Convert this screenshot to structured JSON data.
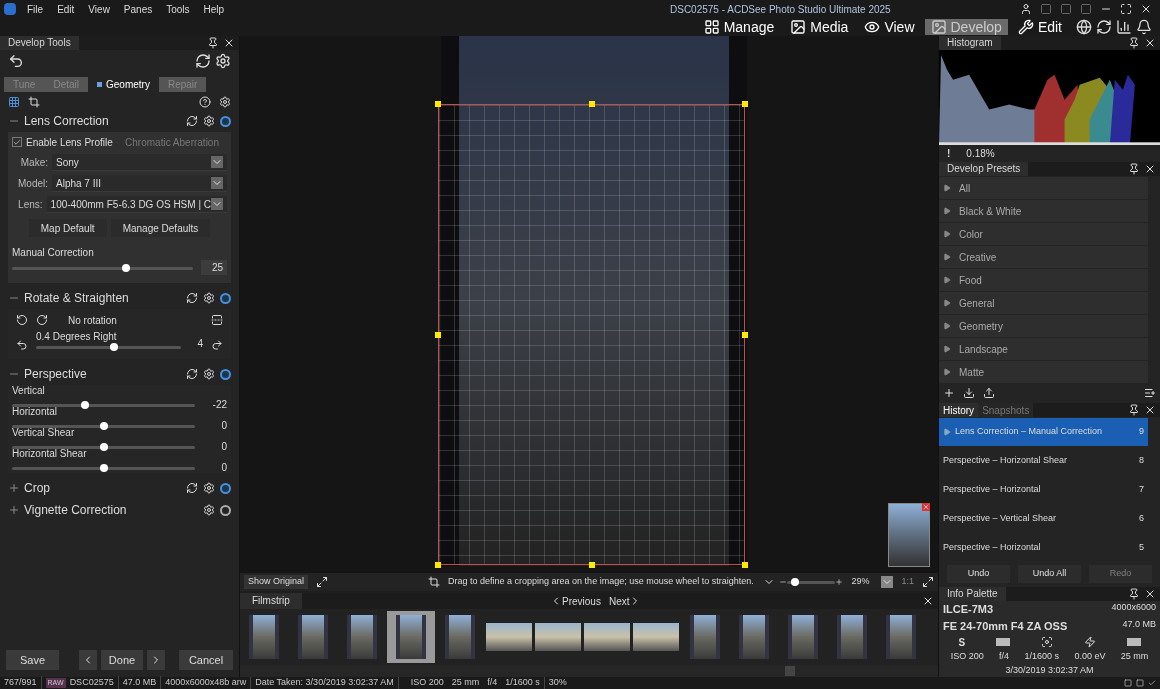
{
  "menu": [
    "File",
    "Edit",
    "View",
    "Panes",
    "Tools",
    "Help"
  ],
  "window": {
    "title": "DSC02575 - ACDSee Photo Studio Ultimate 2025"
  },
  "modes": [
    {
      "label": "Manage",
      "selected": false
    },
    {
      "label": "Media",
      "selected": false
    },
    {
      "label": "View",
      "selected": false
    },
    {
      "label": "Develop",
      "selected": true
    },
    {
      "label": "Edit",
      "selected": false
    }
  ],
  "develop_tools": {
    "title": "Develop Tools",
    "tabs": [
      {
        "label": "Tune",
        "selected": false
      },
      {
        "label": "Detail",
        "selected": false
      },
      {
        "label": "Geometry",
        "selected": true
      },
      {
        "label": "Repair",
        "selected": false
      }
    ]
  },
  "sections": [
    {
      "kind": "lens",
      "title": "Lens Correction",
      "expanded": true,
      "enabled": true,
      "profile": {
        "label": "Enable Lens Profile",
        "checked": true
      },
      "aberration": "Chromatic Aberration",
      "fields": [
        {
          "label": "Make:",
          "value": "Sony"
        },
        {
          "label": "Model:",
          "value": "Alpha 7 III"
        },
        {
          "label": "Lens:",
          "value": "100-400mm F5-6.3 DG OS HSM | C"
        }
      ],
      "buttons": [
        "Map Default",
        "Manage Defaults"
      ],
      "slider": {
        "label": "Manual Correction",
        "level": 0.63,
        "reading": "25"
      }
    },
    {
      "kind": "rotate",
      "title": "Rotate & Straighten",
      "expanded": true,
      "enabled": true,
      "status": "No rotation",
      "slider": {
        "label": "0.4 Degrees Right",
        "level": 0.54,
        "reading": "4"
      }
    },
    {
      "kind": "perspective",
      "title": "Perspective",
      "expanded": true,
      "enabled": true,
      "sliders": [
        {
          "label": "Vertical",
          "level": 0.4,
          "reading": "-22"
        },
        {
          "label": "Horizontal",
          "level": 0.5,
          "reading": "0"
        },
        {
          "label": "Vertical Shear",
          "level": 0.5,
          "reading": "0"
        },
        {
          "label": "Horizontal Shear",
          "level": 0.5,
          "reading": "0"
        }
      ]
    },
    {
      "kind": "crop",
      "title": "Crop",
      "expanded": false,
      "enabled": true
    },
    {
      "kind": "vignette",
      "title": "Vignette Correction",
      "expanded": false,
      "enabled": false
    }
  ],
  "footer_buttons": {
    "save": "Save",
    "done": "Done",
    "cancel": "Cancel"
  },
  "viewer_bar": {
    "show_original": "Show Original",
    "hint": "Drag to define a cropping area on the image; use mouse wheel to straighten.",
    "zoom": {
      "level": 0.15
    },
    "zoom_reading": "29%",
    "actual_size": "1:1"
  },
  "filmstrip": {
    "title": "Filmstrip",
    "previous": "Previous",
    "next": "Next",
    "thumbs": [
      {
        "kind": "portrait",
        "selected": false
      },
      {
        "kind": "portrait",
        "selected": false
      },
      {
        "kind": "portrait",
        "selected": false
      },
      {
        "kind": "portrait",
        "selected": true
      },
      {
        "kind": "portrait",
        "selected": false
      },
      {
        "kind": "landscape",
        "selected": false
      },
      {
        "kind": "landscape",
        "selected": false
      },
      {
        "kind": "landscape",
        "selected": false
      },
      {
        "kind": "landscape",
        "selected": false
      },
      {
        "kind": "portrait",
        "selected": false
      },
      {
        "kind": "portrait",
        "selected": false
      },
      {
        "kind": "portrait",
        "selected": false
      },
      {
        "kind": "portrait",
        "selected": false
      },
      {
        "kind": "portrait",
        "selected": false
      }
    ]
  },
  "histogram": {
    "title": "Histogram",
    "clip_mark": "!",
    "clipping": "0.18%"
  },
  "presets": {
    "title": "Develop Presets",
    "items": [
      "All",
      "Black & White",
      "Color",
      "Creative",
      "Food",
      "General",
      "Geometry",
      "Landscape",
      "Matte"
    ]
  },
  "history": {
    "tabs": [
      {
        "label": "History",
        "selected": true
      },
      {
        "label": "Snapshots",
        "selected": false
      }
    ],
    "items": [
      {
        "label": "Lens Correction – Manual Correction",
        "number": "9",
        "selected": true
      },
      {
        "label": "Perspective – Horizontal Shear",
        "number": "8",
        "selected": false
      },
      {
        "label": "Perspective – Horizontal",
        "number": "7",
        "selected": false
      },
      {
        "label": "Perspective – Vertical Shear",
        "number": "6",
        "selected": false
      },
      {
        "label": "Perspective – Horizontal",
        "number": "5",
        "selected": false
      }
    ],
    "buttons": [
      {
        "label": "Undo",
        "disabled": false
      },
      {
        "label": "Undo All",
        "disabled": false
      },
      {
        "label": "Redo",
        "disabled": true
      }
    ]
  },
  "info": {
    "title": "Info Palette",
    "camera": "ILCE-7M3",
    "lens": "FE 24-70mm F4 ZA OSS",
    "dimensions": "4000x6000",
    "size": "47.0 MB",
    "mode": "S",
    "values": [
      "ISO 200",
      "f/4",
      "1/1600 s",
      "0.00 eV",
      "25 mm"
    ],
    "date": "3/30/2019 3:02:37 AM"
  },
  "status_bar": {
    "count": "767/991",
    "badge": "RAW",
    "items": [
      "DSC02575",
      "47.0 MB",
      "4000x6000x48b arw",
      "Date Taken: 3/30/2019 3:02:37 AM"
    ],
    "exif": [
      "ISO 200",
      "25 mm",
      "f/4",
      "1/1600 s"
    ],
    "zoom": "30%"
  }
}
